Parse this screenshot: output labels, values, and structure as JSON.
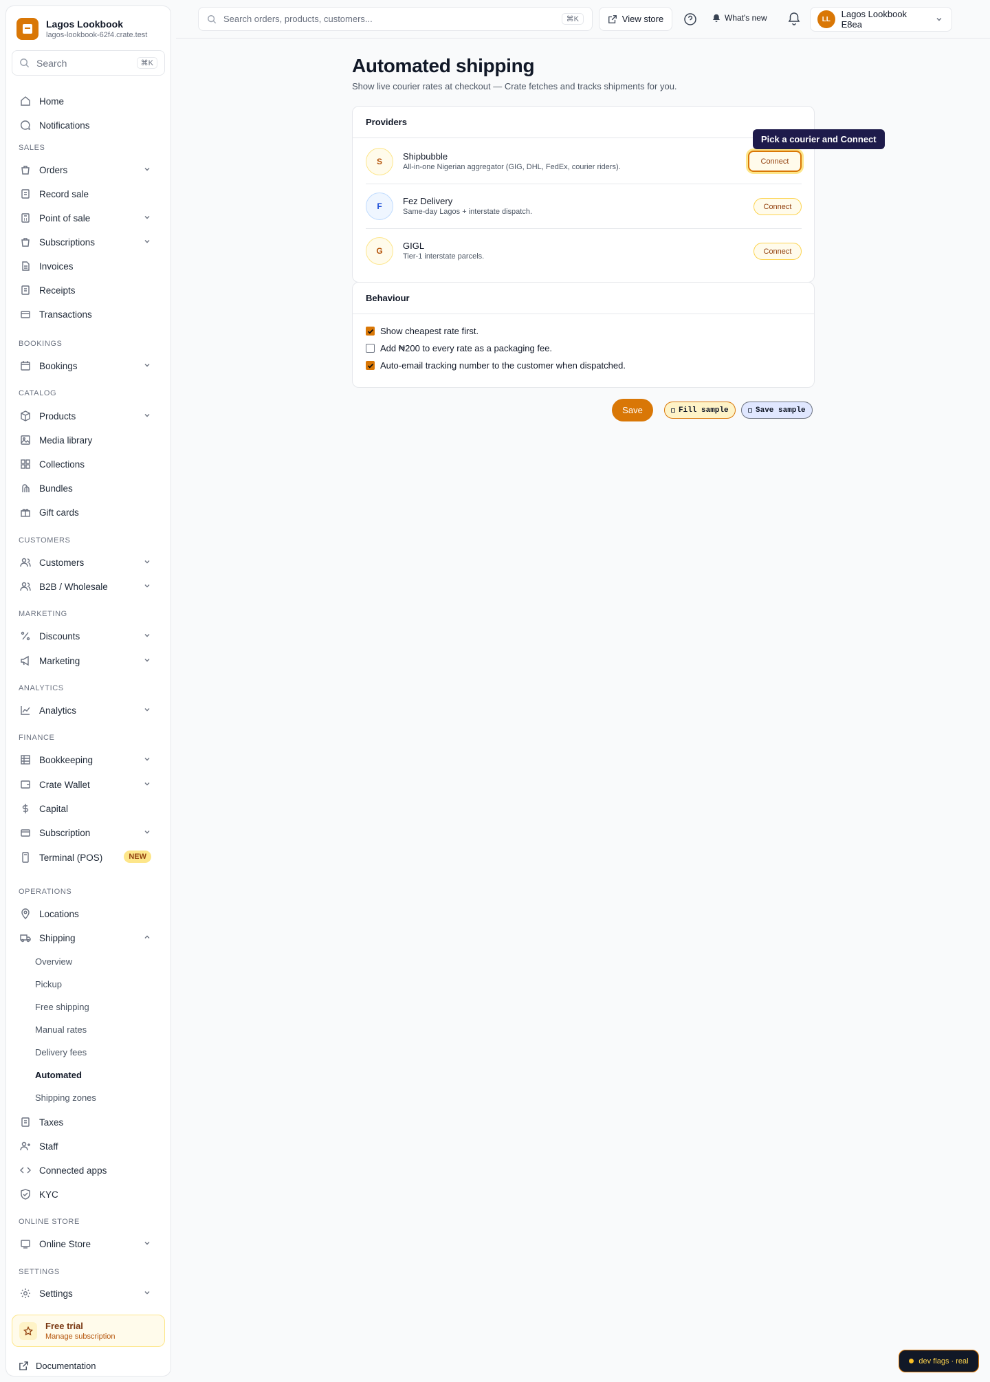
{
  "brand": {
    "name": "Lagos Lookbook",
    "domain": "lagos-lookbook-62f4.crate.test"
  },
  "sidebar": {
    "search_label": "Search",
    "search_kbd": "⌘K",
    "sections": {
      "sales": "SALES",
      "bookings": "BOOKINGS",
      "catalog": "CATALOG",
      "customers": "CUSTOMERS",
      "marketing": "MARKETING",
      "analytics": "ANALYTICS",
      "finance": "FINANCE",
      "operations": "OPERATIONS",
      "online_store": "ONLINE STORE",
      "settings": "SETTINGS"
    },
    "items": {
      "home": "Home",
      "notifications": "Notifications",
      "orders": "Orders",
      "record_sale": "Record sale",
      "point_of_sale": "Point of sale",
      "subscriptions": "Subscriptions",
      "invoices": "Invoices",
      "receipts": "Receipts",
      "transactions": "Transactions",
      "bookings": "Bookings",
      "products": "Products",
      "media_library": "Media library",
      "collections": "Collections",
      "bundles": "Bundles",
      "gift_cards": "Gift cards",
      "customers": "Customers",
      "b2b": "B2B / Wholesale",
      "discounts": "Discounts",
      "marketing": "Marketing",
      "analytics": "Analytics",
      "bookkeeping": "Bookkeeping",
      "crate_wallet": "Crate Wallet",
      "capital": "Capital",
      "subscription": "Subscription",
      "terminal": "Terminal (POS)",
      "locations": "Locations",
      "shipping": "Shipping",
      "taxes": "Taxes",
      "staff": "Staff",
      "connected_apps": "Connected apps",
      "kyc": "KYC",
      "online_store": "Online Store",
      "settings": "Settings"
    },
    "terminal_badge": "NEW",
    "shipping_sub": [
      "Overview",
      "Pickup",
      "Free shipping",
      "Manual rates",
      "Delivery fees",
      "Automated",
      "Shipping zones"
    ],
    "trial": {
      "title": "Free trial",
      "subtitle": "Manage subscription"
    },
    "documentation": "Documentation"
  },
  "topbar": {
    "search_placeholder": "Search orders, products, customers...",
    "search_kbd": "⌘K",
    "view_store": "View store",
    "whats_new": "What's new",
    "account_initials": "LL",
    "account_name": "Lagos Lookbook E8ea"
  },
  "page": {
    "title": "Automated shipping",
    "subtitle": "Show live courier rates at checkout — Crate fetches and tracks shipments for you."
  },
  "providers": {
    "heading": "Providers",
    "items": [
      {
        "initial": "S",
        "name": "Shipbubble",
        "desc": "All-in-one Nigerian aggregator (GIG, DHL, FedEx, courier riders).",
        "button": "Connect"
      },
      {
        "initial": "F",
        "name": "Fez Delivery",
        "desc": "Same-day Lagos + interstate dispatch.",
        "button": "Connect"
      },
      {
        "initial": "G",
        "name": "GIGL",
        "desc": "Tier-1 interstate parcels.",
        "button": "Connect"
      }
    ],
    "tooltip": "Pick a courier and Connect"
  },
  "behaviour": {
    "heading": "Behaviour",
    "options": [
      {
        "label": "Show cheapest rate first.",
        "checked": true
      },
      {
        "label": "Add ₦200 to every rate as a packaging fee.",
        "checked": false
      },
      {
        "label": "Auto-email tracking number to the customer when dispatched.",
        "checked": true
      }
    ]
  },
  "actions": {
    "save": "Save",
    "fill_sample": "Fill sample",
    "save_sample": "Save sample"
  },
  "dev_flags": "dev flags · real",
  "colors": {
    "accent": "#d97706",
    "tooltip_bg": "#1e1b4b",
    "tint_amber": "#fffbeb",
    "tint_blue": "#eff6ff"
  }
}
